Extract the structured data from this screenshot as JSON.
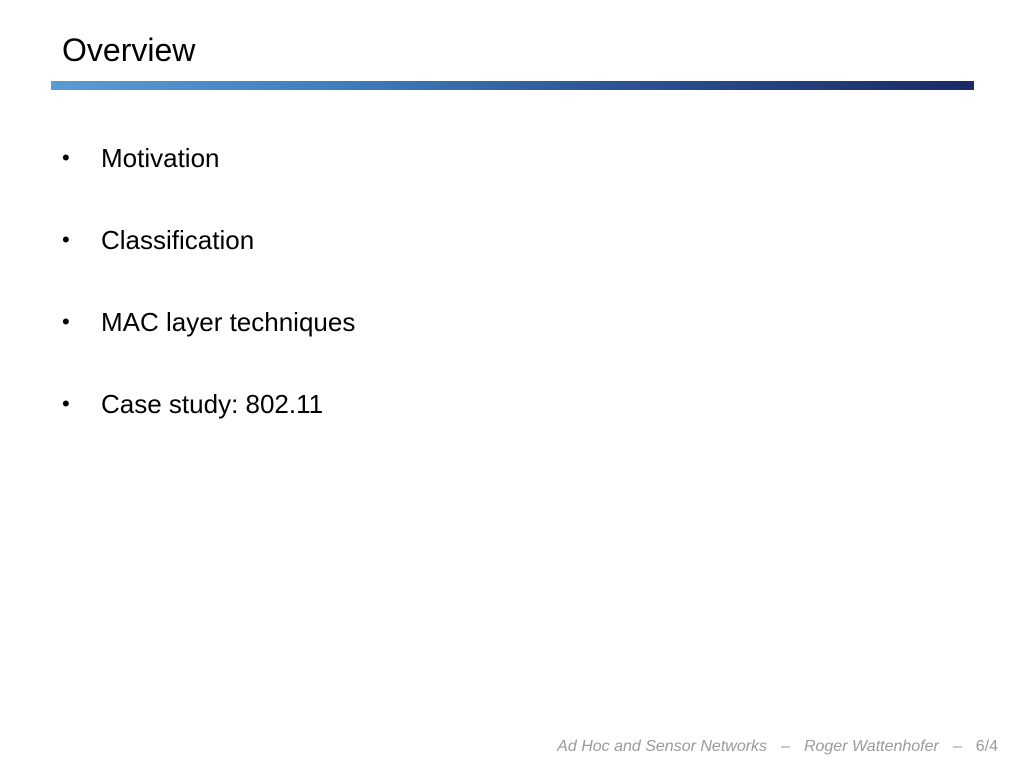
{
  "slide": {
    "title": "Overview",
    "bullets": [
      {
        "marker": "•",
        "text": "Motivation"
      },
      {
        "marker": "•",
        "text": "Classification"
      },
      {
        "marker": "•",
        "text": "MAC layer techniques"
      },
      {
        "marker": "•",
        "text": "Case study: 802.11"
      }
    ]
  },
  "footer": {
    "course": "Ad Hoc and Sensor Networks",
    "separator": "–",
    "author": "Roger Wattenhofer",
    "page": "6/4"
  },
  "colors": {
    "title_bar_start": "#5b9bd5",
    "title_bar_end": "#1a2a66",
    "footer_text": "#9a9a9a"
  }
}
